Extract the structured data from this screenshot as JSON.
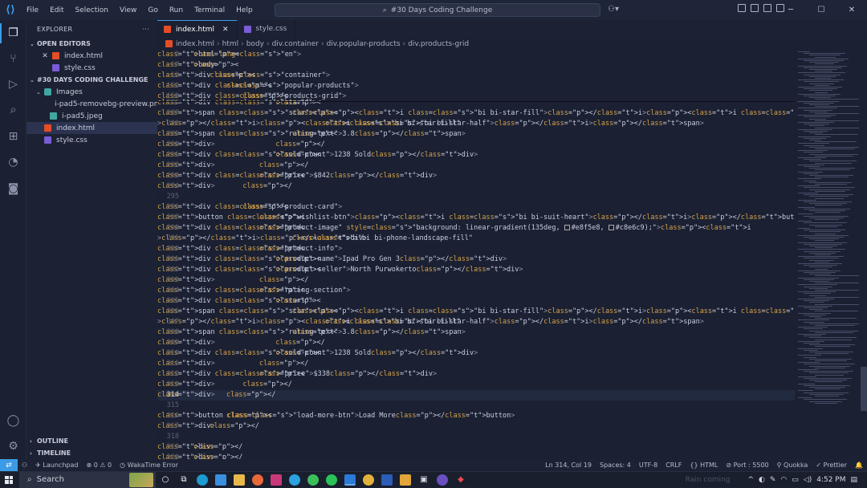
{
  "titlebar": {
    "menu": [
      "File",
      "Edit",
      "Selection",
      "View",
      "Go",
      "Run",
      "Terminal",
      "Help"
    ],
    "search_text": "#30 Days Coding Challenge"
  },
  "sidebar": {
    "title": "EXPLORER",
    "more": "···",
    "open_editors_label": "OPEN EDITORS",
    "open_editors": [
      "index.html",
      "style.css"
    ],
    "project_label": "#30 DAYS CODING CHALLENGE",
    "folder": "Images",
    "images": [
      "i-pad5-removebg-preview.png",
      "i-pad5.jpeg"
    ],
    "files": [
      "index.html",
      "style.css"
    ],
    "outline_label": "OUTLINE",
    "timeline_label": "TIMELINE"
  },
  "tabs": [
    {
      "label": "index.html",
      "active": true,
      "type": "html"
    },
    {
      "label": "style.css",
      "active": false,
      "type": "css"
    }
  ],
  "breadcrumb": [
    "index.html",
    "html",
    "body",
    "div.container",
    "div.popular-products",
    "div.products-grid"
  ],
  "editor": {
    "current_line": "314",
    "sticky_lines": [
      {
        "n": "2",
        "code": "<html lang=\"en\">"
      },
      {
        "n": "17",
        "code": "<body>"
      },
      {
        "n": "13",
        "code": "    <div class=\"container\">"
      },
      {
        "n": "152",
        "code": "        <div class=\"popular-products\">"
      },
      {
        "n": "158",
        "code": "            <div class=\"products-grid\">"
      }
    ],
    "lines": [
      {
        "n": "286",
        "code": "                    <div class=\"stars\">"
      },
      {
        "n": "287",
        "code": "                        <span class=\"star\"><i class=\"bi bi-star-fill\"></i><i class=\"bi bi-star-fill\"></i><i"
      },
      {
        "n": "288",
        "code": "                                class=\"bi bi-star-fill\"></i><i class=\"bi bi-star-half\"></i></span>"
      },
      {
        "n": "289",
        "code": "                        <span class=\"rating-text\">3.8</span>"
      },
      {
        "n": "290",
        "code": "                    </div>"
      },
      {
        "n": "291",
        "code": "                    <div class=\"sold-count\">1238 Sold</div>"
      },
      {
        "n": "292",
        "code": "                </div>"
      },
      {
        "n": "293",
        "code": "                <div class=\"price\">$842</div>"
      },
      {
        "n": "294",
        "code": "            </div>"
      },
      {
        "n": "295",
        "code": ""
      },
      {
        "n": "296",
        "code": "            <div class=\"product-card\">"
      },
      {
        "n": "297",
        "code": "                <button class=\"wishlist-btn\"><i class=\"bi bi-suit-heart\"></i></button>"
      },
      {
        "n": "298",
        "code": "                <div class=\"product-image\" style=\"background: linear-gradient(135deg, ■#e8f5e8, ■#c8e6c9);\"><i"
      },
      {
        "n": "299",
        "code": "                        class=\"bi bi-phone-landscape-fill\"></i></div>"
      },
      {
        "n": "300",
        "code": "                <div class=\"product-info\">"
      },
      {
        "n": "301",
        "code": "                    <div class=\"product-name\">Ipad Pro Gen 3</div>"
      },
      {
        "n": "302",
        "code": "                    <div class=\"product-seller\">North Purwokerto</div>"
      },
      {
        "n": "303",
        "code": "                </div>"
      },
      {
        "n": "304",
        "code": "                <div class=\"rating-section\">"
      },
      {
        "n": "305",
        "code": "                    <div class=\"stars\">"
      },
      {
        "n": "306",
        "code": "                        <span class=\"star\"><i class=\"bi bi-star-fill\"></i><i class=\"bi bi-star-fill\"></i><i"
      },
      {
        "n": "307",
        "code": "                                class=\"bi bi-star-fill\"></i><i class=\"bi bi-star-half\"></i></span>"
      },
      {
        "n": "308",
        "code": "                        <span class=\"rating-text\">3.8</span>"
      },
      {
        "n": "309",
        "code": "                    </div>"
      },
      {
        "n": "310",
        "code": "                    <div class=\"sold-count\">1238 Sold</div>"
      },
      {
        "n": "311",
        "code": "                </div>"
      },
      {
        "n": "312",
        "code": "                <div class=\"price\">$338</div>"
      },
      {
        "n": "313",
        "code": "            </div>"
      },
      {
        "n": "314",
        "code": "        </div>"
      },
      {
        "n": "315",
        "code": ""
      },
      {
        "n": "316",
        "code": "        <button class=\"load-more-btn\">Load More</button>"
      },
      {
        "n": "317",
        "code": "    </div>"
      },
      {
        "n": "318",
        "code": ""
      },
      {
        "n": "319",
        "code": "</div>"
      },
      {
        "n": "320",
        "code": "</div>"
      }
    ]
  },
  "statusbar": {
    "launchpad": "Launchpad",
    "problems": "⊗ 0 ⚠ 0",
    "wakatime": "WakaTime Error",
    "position": "Ln 314, Col 19",
    "spaces": "Spaces: 4",
    "encoding": "UTF-8",
    "eol": "CRLF",
    "language": "HTML",
    "port": "Port : 5500",
    "quokka": "Quokka",
    "prettier": "Prettier"
  },
  "taskbar": {
    "search": "Search",
    "faded_text": "Rain coming",
    "time": "4:52 PM"
  },
  "colors": {
    "accent": "#3c9be6",
    "tag": "#e8c46a",
    "attribute": "#d6a24a"
  }
}
